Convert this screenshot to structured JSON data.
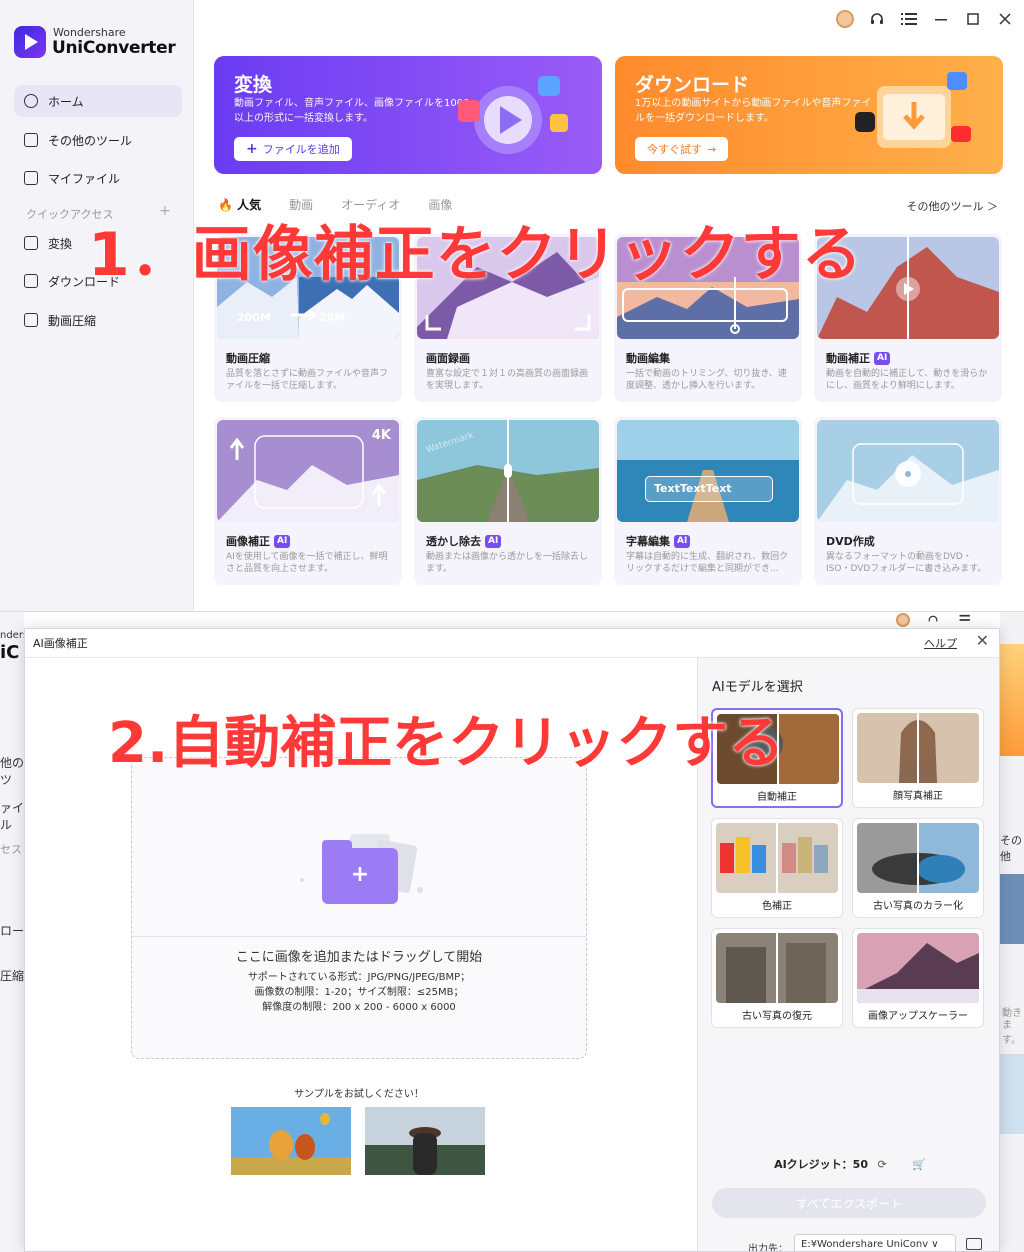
{
  "app": {
    "brand_sub": "Wondershare",
    "brand_main": "UniConverter"
  },
  "sidebar": {
    "items": [
      {
        "label": "ホーム",
        "icon": "home-icon"
      },
      {
        "label": "その他のツール",
        "icon": "toolbox-icon"
      },
      {
        "label": "マイファイル",
        "icon": "file-icon"
      }
    ],
    "quick_access_label": "クイックアクセス",
    "quick_access_plus": "+",
    "quick_items": [
      {
        "label": "変換",
        "icon": "convert-icon"
      },
      {
        "label": "ダウンロード",
        "icon": "download-icon"
      },
      {
        "label": "動画圧縮",
        "icon": "compress-icon"
      }
    ]
  },
  "banners": {
    "convert": {
      "title": "変換",
      "desc": "動画ファイル、音声ファイル、画像ファイルを1000以上の形式に一括変換します。",
      "button": "ファイルを追加"
    },
    "download": {
      "title": "ダウンロード",
      "desc": "1万以上の動画サイトから動画ファイルや音声ファイルを一括ダウンロードします。",
      "button": "今すぐ試す"
    }
  },
  "tabs": [
    "人気",
    "動画",
    "オーディオ",
    "画像"
  ],
  "more_tools": "その他のツール ＞",
  "cards": [
    {
      "title": "動画圧縮",
      "ai": false,
      "desc": "品質を落とさずに動画ファイルや音声ファイルを一括で圧縮します。",
      "thumb_left": "200M",
      "thumb_right": "20M"
    },
    {
      "title": "画面録画",
      "ai": false,
      "desc": "豊富な設定で１対１の高画質の画面録画を実現します。"
    },
    {
      "title": "動画編集",
      "ai": false,
      "desc": "一括で動画のトリミング、切り抜き、速度調整、透かし挿入を行います。"
    },
    {
      "title": "動画補正",
      "ai": true,
      "desc": "動画を自動的に補正して、動きを滑らかにし、画質をより鮮明にします。"
    },
    {
      "title": "画像補正",
      "ai": true,
      "desc": "AIを使用して画像を一括で補正し、鮮明さと品質を向上させます。",
      "thumb_badge": "4K"
    },
    {
      "title": "透かし除去",
      "ai": true,
      "desc": "動画または画像から透かしを一括除去します。",
      "thumb_text": "Watermark"
    },
    {
      "title": "字幕編集",
      "ai": true,
      "desc": "字幕は自動的に生成、翻訳され、数回クリックするだけで編集と同期ができ...",
      "thumb_text": "TextTextText"
    },
    {
      "title": "DVD作成",
      "ai": false,
      "desc": "異なるフォーマットの動画をDVD・ISO・DVDフォルダーに書き込みます。"
    }
  ],
  "ai_badge": "AI",
  "annotations": {
    "step1": "1．画像補正をクリックする",
    "step2": "2.自動補正をクリックする"
  },
  "dialog": {
    "title": "AI画像補正",
    "help": "ヘルプ",
    "close": "✕",
    "drop_plus": "+",
    "drop_main": "ここに画像を追加またはドラッグして開始",
    "drop_formats": "サポートされている形式：JPG/PNG/JPEG/BMP；",
    "drop_limits": "画像数の制限：1-20；サイズ制限：≤25MB；",
    "drop_resolution": "解像度の制限：200 x 200 - 6000 x 6000",
    "sample_label": "サンプルをお試しください！",
    "model_title": "AIモデルを選択",
    "models": [
      {
        "label": "自動補正",
        "selected": true
      },
      {
        "label": "顔写真補正",
        "selected": false
      },
      {
        "label": "色補正",
        "selected": false
      },
      {
        "label": "古い写真のカラー化",
        "selected": false
      },
      {
        "label": "古い写真の復元",
        "selected": false
      },
      {
        "label": "画像アップスケーラー",
        "selected": false
      }
    ],
    "credits": "AIクレジット：50",
    "export_button": "すべてエクスポート",
    "output_label": "出力先：",
    "output_path": "E:¥Wondershare UniConv ∨"
  },
  "behind_fragments": {
    "left": [
      "nders",
      "iC",
      "他のツ",
      "ァイル",
      "セス",
      "ロー",
      "圧縮"
    ],
    "right": [
      "その他",
      "動き",
      "ます。"
    ]
  },
  "colors": {
    "accent": "#7a4df0",
    "annotation": "#ff3838",
    "download_orange": "#ff8a2c"
  }
}
